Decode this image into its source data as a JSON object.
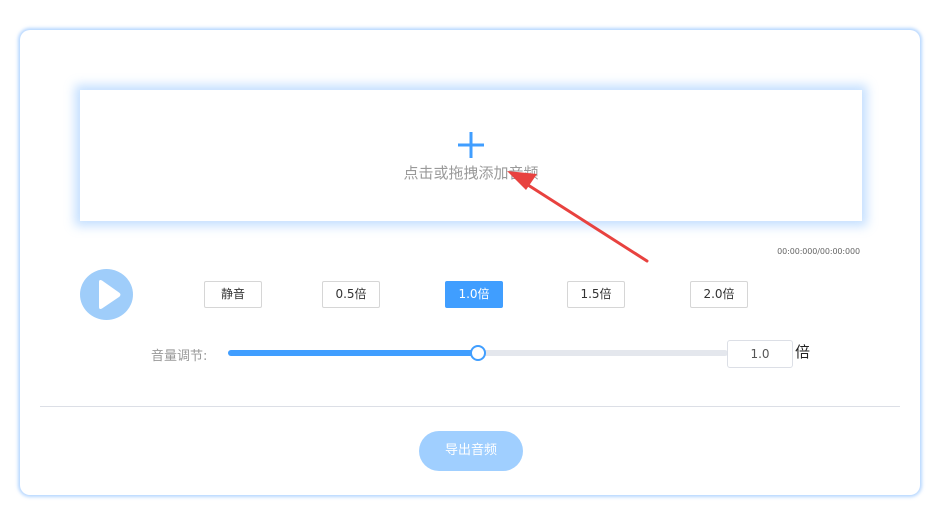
{
  "upload": {
    "prompt": "点击或拖拽添加音频",
    "icon": "plus-icon"
  },
  "player": {
    "time_readout": "00:00:000/00:00:000",
    "play_icon": "play-icon"
  },
  "speed": {
    "mute_label": "静音",
    "options": [
      {
        "label": "0.5倍"
      },
      {
        "label": "1.0倍",
        "selected": true
      },
      {
        "label": "1.5倍"
      },
      {
        "label": "2.0倍"
      }
    ]
  },
  "volume": {
    "label": "音量调节:",
    "fraction": 0.5,
    "value": "1.0",
    "unit": "倍"
  },
  "export": {
    "label": "导出音频"
  },
  "colors": {
    "accent": "#409eff",
    "accent_light": "#a0cfff",
    "arrow": "#e8423f"
  }
}
